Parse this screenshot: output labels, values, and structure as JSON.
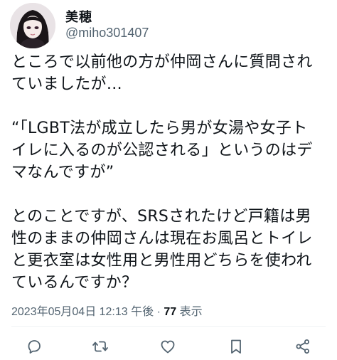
{
  "author": {
    "display_name": "美穂",
    "handle": "@miho301407"
  },
  "tweet": {
    "lines_p1": [
      "ところで以前他の方が仲岡さんに質問され",
      "ていましたが…"
    ],
    "lines_p2": [
      "“「LGBT法が成立したら男が女湯や女子ト",
      "イレに入るのが公認される」というのはデ",
      "マなんですが”"
    ],
    "lines_p3": [
      "とのことですが、SRSされたけど戸籍は男",
      "性のままの仲岡さんは現在お風呂とトイレ",
      "と更衣室は女性用と男性用どちらを使われ",
      "ているんですか？"
    ]
  },
  "meta": {
    "timestamp": "2023年05月04日 12:13 午後",
    "separator": " · ",
    "views_count": "77",
    "views_label": " 表示"
  },
  "actions": [
    {
      "name": "reply",
      "icon": "reply-icon"
    },
    {
      "name": "retweet",
      "icon": "retweet-icon"
    },
    {
      "name": "like",
      "icon": "heart-icon"
    },
    {
      "name": "bookmark",
      "icon": "bookmark-icon"
    },
    {
      "name": "share",
      "icon": "share-icon"
    }
  ],
  "colors": {
    "text": "#0f1419",
    "secondary": "#536471",
    "divider": "#eff3f4",
    "icon": "#536471"
  }
}
